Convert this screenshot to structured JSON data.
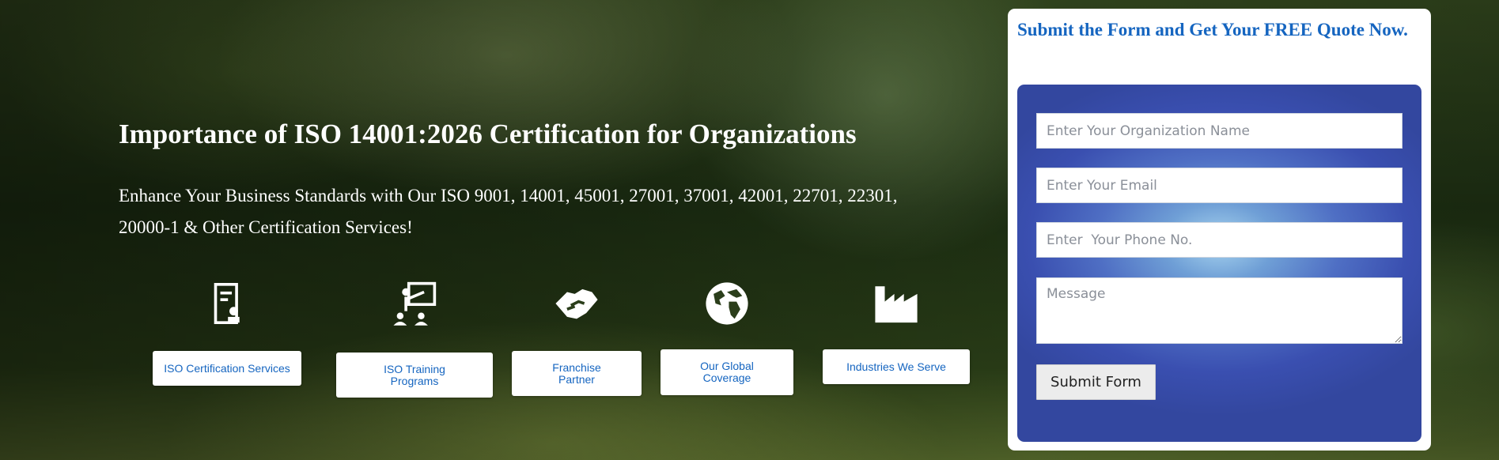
{
  "hero": {
    "title": "Importance of ISO 14001:2026 Certification for Organizations",
    "subtitle": "Enhance Your Business Standards with Our ISO 9001, 14001, 45001, 27001, 37001, 42001, 22701, 22301, 20000-1 & Other Certification Services!"
  },
  "services": [
    {
      "label": "ISO Certification Services",
      "icon": "certificate-icon"
    },
    {
      "label": "ISO Training Programs",
      "icon": "training-presentation-icon"
    },
    {
      "label": "Franchise Partner",
      "icon": "handshake-icon"
    },
    {
      "label": "Our Global Coverage",
      "icon": "globe-icon"
    },
    {
      "label": "Industries We Serve",
      "icon": "factory-icon"
    }
  ],
  "form": {
    "heading": "Submit the Form and Get Your FREE Quote Now.",
    "organization_placeholder": "Enter Your Organization Name",
    "email_placeholder": "Enter Your Email",
    "phone_placeholder": "Enter  Your Phone No.",
    "message_placeholder": "Message",
    "submit_label": "Submit Form"
  },
  "colors": {
    "accent": "#1565c0",
    "form_panel": "#3a4fb0",
    "text_light": "#ffffff"
  }
}
